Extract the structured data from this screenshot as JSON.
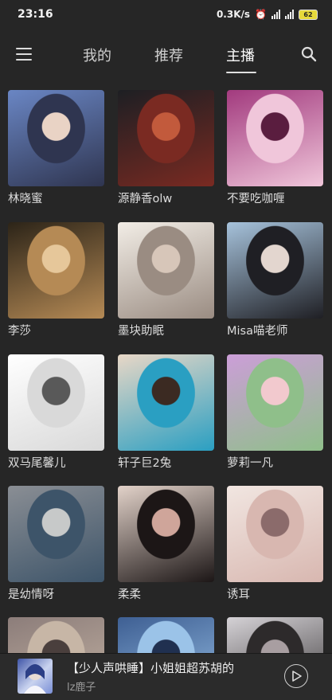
{
  "status_bar": {
    "time": "23:16",
    "net_speed": "0.3K/s",
    "battery": "62"
  },
  "header": {
    "tabs": [
      "我的",
      "推荐",
      "主播"
    ],
    "active_tab": "主播"
  },
  "anchors": [
    {
      "name": "林晓蜜",
      "colors": [
        "#6a86c4",
        "#2f3550",
        "#e9d3c5"
      ]
    },
    {
      "name": "源静香olw",
      "colors": [
        "#1d1f23",
        "#7a2a22",
        "#c25a3c"
      ]
    },
    {
      "name": "不要吃咖喱",
      "colors": [
        "#a23a7e",
        "#f0c6da",
        "#5a1d3f"
      ]
    },
    {
      "name": "李莎",
      "colors": [
        "#2c2418",
        "#b58a55",
        "#e6c79a"
      ]
    },
    {
      "name": "墨块助眠",
      "colors": [
        "#f2ede6",
        "#9a8c82",
        "#d7c6b9"
      ]
    },
    {
      "name": "Misa喵老师",
      "colors": [
        "#a6c2db",
        "#1f1f24",
        "#e3d6cf"
      ]
    },
    {
      "name": "双马尾馨儿",
      "colors": [
        "#ffffff",
        "#d9d9d9",
        "#595959"
      ]
    },
    {
      "name": "轩子巨2兔",
      "colors": [
        "#e8d7c6",
        "#2a9fc2",
        "#3b2a22"
      ]
    },
    {
      "name": "萝莉一凡",
      "colors": [
        "#cc9ed8",
        "#8fbf8a",
        "#f2c9ce"
      ]
    },
    {
      "name": "是幼情呀",
      "colors": [
        "#8a8e94",
        "#3d5469",
        "#c7c9c9"
      ]
    },
    {
      "name": "柔柔",
      "colors": [
        "#e2d2c9",
        "#1c1616",
        "#cfa59a"
      ]
    },
    {
      "name": "诱耳",
      "colors": [
        "#f1e6e1",
        "#d8b7b0",
        "#8b6b6b"
      ]
    },
    {
      "name": "",
      "colors": [
        "#8c7d7a",
        "#c7b6a6",
        "#4a3f3d"
      ]
    },
    {
      "name": "",
      "colors": [
        "#3e5f93",
        "#9bc3e8",
        "#203050"
      ]
    },
    {
      "name": "",
      "colors": [
        "#d5d2d6",
        "#2d2a2b",
        "#a89ea1"
      ]
    }
  ],
  "now_playing": {
    "title": "【少人声哄睡】小姐姐超苏胡的",
    "artist": "lz鹿子"
  }
}
